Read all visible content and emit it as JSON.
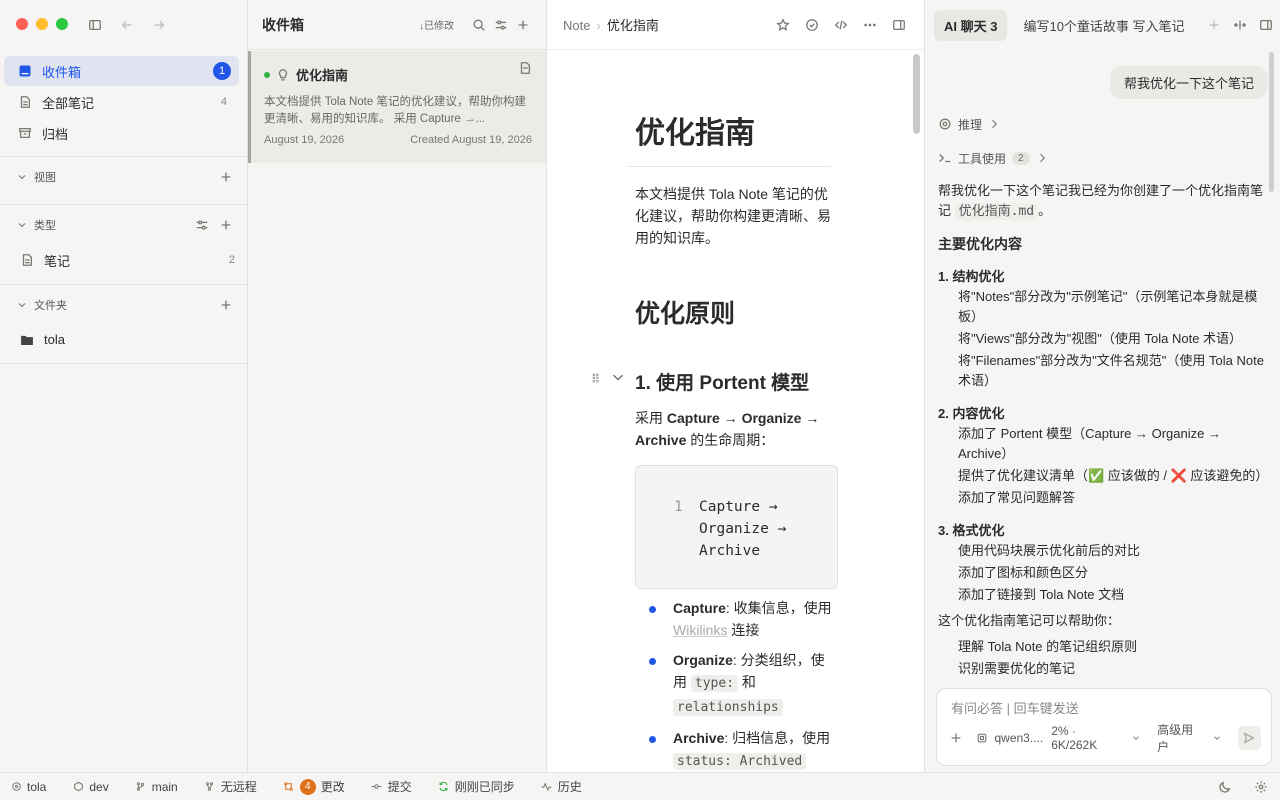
{
  "sidebar": {
    "nav": [
      {
        "label": "收件箱",
        "badge": "1"
      },
      {
        "label": "全部笔记",
        "count": "4"
      },
      {
        "label": "归档"
      }
    ],
    "views_label": "视图",
    "types_label": "类型",
    "types_items": [
      {
        "label": "笔记",
        "count": "2"
      }
    ],
    "folders_label": "文件夹",
    "folders_items": [
      {
        "label": "tola"
      }
    ]
  },
  "list": {
    "title": "收件箱",
    "sort_label": "↓已修改",
    "card": {
      "title": "优化指南",
      "desc": "本文档提供 Tola Note 笔记的优化建议，帮助你构建更清晰、易用的知识库。 采用 Capture →...",
      "date": "August 19, 2026",
      "created": "Created August 19, 2026"
    }
  },
  "editor": {
    "crumb_root": "Note",
    "crumb_current": "优化指南",
    "title": "优化指南",
    "intro": "本文档提供 Tola Note 笔记的优化建议，帮助你构建更清晰、易用的知识库。",
    "h2": "优化原则",
    "h3": "1. 使用 Portent 模型",
    "p1_prefix": "采用 ",
    "p1_bold": "Capture → Organize → Archive",
    "p1_suffix": " 的生命周期：",
    "code_line_no": "1",
    "code_text": "Capture → Organize → Archive",
    "bullets": [
      {
        "bold": "Capture",
        "text": ": 收集信息，使用 ",
        "link": "Wikilinks",
        "tail": " 连接"
      },
      {
        "bold": "Organize",
        "text": ": 分类组织，使用 ",
        "code1": "type:",
        "mid": " 和 ",
        "code2": "relationships"
      },
      {
        "bold": "Archive",
        "text": ": 归档信息，使用 ",
        "code1": "status: Archived"
      }
    ]
  },
  "ai": {
    "tab_active": "AI 聊天 3",
    "tab_other": "编写10个童话故事 写入笔记",
    "user_msg": "帮我优化一下这个笔记",
    "reasoning_label": "推理",
    "tools_label": "工具使用",
    "tools_count": "2",
    "reply_intro": "帮我优化一下这个笔记我已经为你创建了一个优化指南笔记 ",
    "reply_file": "优化指南.md",
    "reply_intro_end": "。",
    "heading": "主要优化内容",
    "sections": [
      {
        "title": "1. 结构优化",
        "items": [
          "将\"Notes\"部分改为\"示例笔记\"（示例笔记本身就是模板）",
          "将\"Views\"部分改为\"视图\"（使用 Tola Note 术语）",
          "将\"Filenames\"部分改为\"文件名规范\"（使用 Tola Note 术语）"
        ]
      },
      {
        "title": "2. 内容优化",
        "items": [
          "添加了 Portent 模型（Capture → Organize → Archive）",
          "提供了优化建议清单（✅ 应该做的 / ❌ 应该避免的）",
          "添加了常见问题解答"
        ]
      },
      {
        "title": "3. 格式优化",
        "items": [
          "使用代码块展示优化前后的对比",
          "添加了图标和颜色区分",
          "添加了链接到 Tola Note 文档"
        ]
      }
    ],
    "closing": "这个优化指南笔记可以帮助你：",
    "closing_items": [
      "理解 Tola Note 的笔记组织原则",
      "识别需要优化的笔记"
    ],
    "composer_placeholder": "有问必答 | 回车键发送",
    "model": "qwen3....",
    "usage": "2% · 6K/262K",
    "mode": "高级用户"
  },
  "status": {
    "vault": "tola",
    "env": "dev",
    "branch": "main",
    "remote": "无远程",
    "changes_count": "4",
    "changes_label": "更改",
    "commit": "提交",
    "synced": "刚刚已同步",
    "history": "历史"
  },
  "colors": {
    "accent": "#2156e8",
    "orange": "#e0701c"
  }
}
